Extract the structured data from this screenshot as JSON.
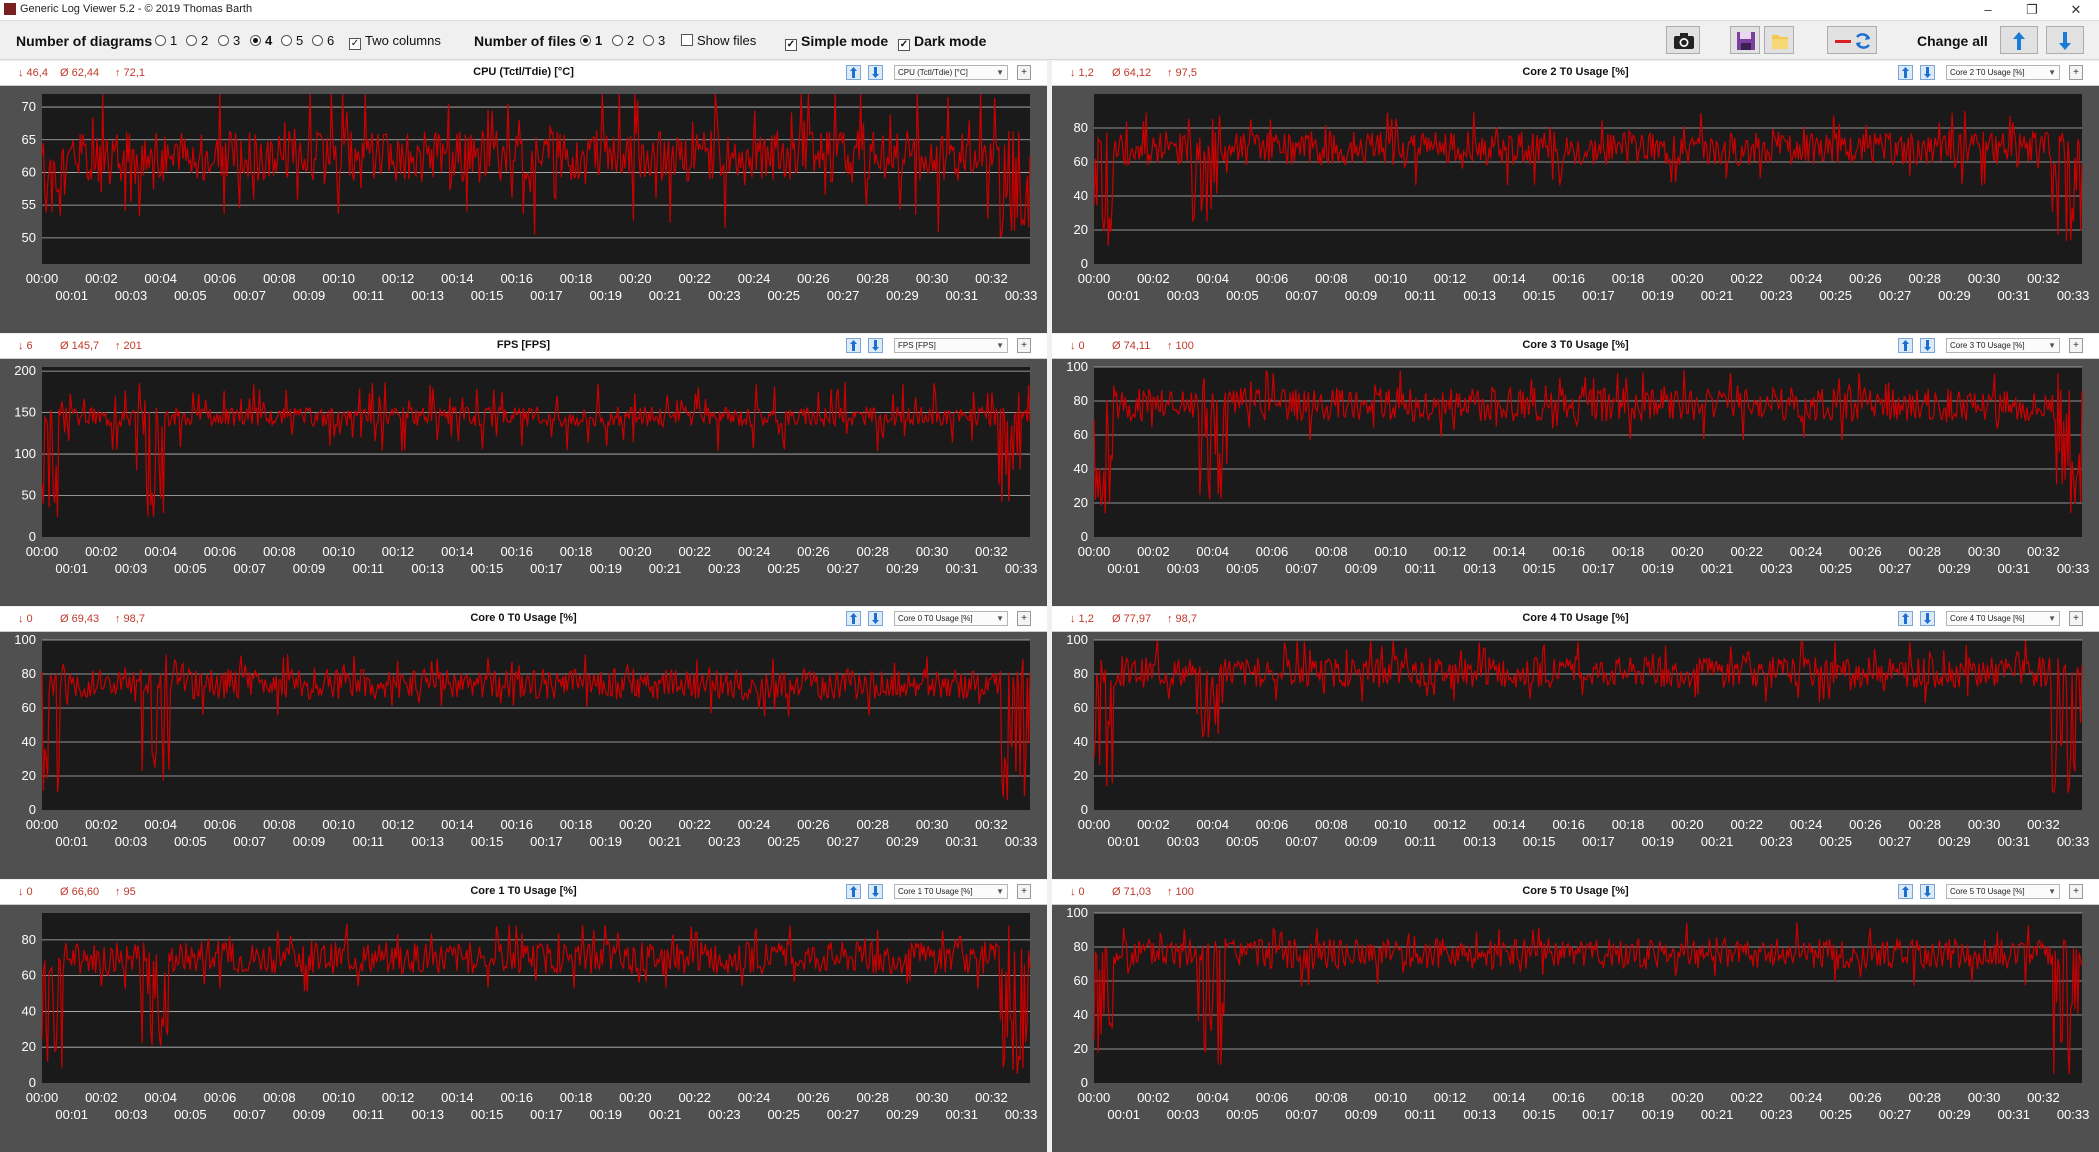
{
  "window": {
    "title": "Generic Log Viewer 5.2 - © 2019 Thomas Barth",
    "minimize": "–",
    "restore": "❐",
    "close": "✕"
  },
  "toolbar": {
    "num_diagrams_label": "Number of diagrams",
    "diagram_options": [
      "1",
      "2",
      "3",
      "4",
      "5",
      "6"
    ],
    "diagram_selected": "4",
    "two_columns_label": "Two columns",
    "two_columns_checked": true,
    "num_files_label": "Number of files",
    "file_options": [
      "1",
      "2",
      "3"
    ],
    "file_selected": "1",
    "show_files_label": "Show files",
    "show_files_checked": false,
    "simple_mode_label": "Simple mode",
    "simple_mode_checked": true,
    "dark_mode_label": "Dark mode",
    "dark_mode_checked": true,
    "change_all_label": "Change all",
    "icons": [
      "camera-icon",
      "save-icon",
      "folder-icon",
      "swap-icon",
      "arrow-up-icon",
      "arrow-down-icon"
    ]
  },
  "colors": {
    "line": "#cc0000",
    "plot_bg": "#1a1a1a",
    "frame_bg": "#505050",
    "grid": "#bbbbbb",
    "stat": "#c0392b"
  },
  "charts": [
    {
      "title": "CPU (Tctl/Tdie) [°C]",
      "select": "CPU (Tctl/Tdie) [°C]",
      "min": "↓ 46,4",
      "avg": "Ø 62,44",
      "max": "↑ 72,1"
    },
    {
      "title": "Core 2 T0 Usage [%]",
      "select": "Core 2 T0 Usage [%]",
      "min": "↓ 1,2",
      "avg": "Ø 64,12",
      "max": "↑ 97,5"
    },
    {
      "title": "FPS [FPS]",
      "select": "FPS [FPS]",
      "min": "↓ 6",
      "avg": "Ø 145,7",
      "max": "↑ 201"
    },
    {
      "title": "Core 3 T0 Usage [%]",
      "select": "Core 3 T0 Usage [%]",
      "min": "↓ 0",
      "avg": "Ø 74,11",
      "max": "↑ 100"
    },
    {
      "title": "Core 0 T0 Usage [%]",
      "select": "Core 0 T0 Usage [%]",
      "min": "↓ 0",
      "avg": "Ø 69,43",
      "max": "↑ 98,7"
    },
    {
      "title": "Core 4 T0 Usage [%]",
      "select": "Core 4 T0 Usage [%]",
      "min": "↓ 1,2",
      "avg": "Ø 77,97",
      "max": "↑ 98,7"
    },
    {
      "title": "Core 1 T0 Usage [%]",
      "select": "Core 1 T0 Usage [%]",
      "min": "↓ 0",
      "avg": "Ø 66,60",
      "max": "↑ 95"
    },
    {
      "title": "Core 5 T0 Usage [%]",
      "select": "Core 5 T0 Usage [%]",
      "min": "↓ 0",
      "avg": "Ø 71,03",
      "max": "↑ 100"
    }
  ],
  "chart_data": [
    {
      "type": "line",
      "title": "CPU (Tctl/Tdie) [°C]",
      "ylim": [
        46,
        72
      ],
      "yticks": [
        50,
        55,
        60,
        65,
        70
      ],
      "x_range_minutes": [
        0,
        33.3
      ],
      "seed": 1,
      "mean": 62.4,
      "spread": 4,
      "spike": 8,
      "dips": [
        [
          0.3,
          52
        ],
        [
          32.8,
          50
        ]
      ],
      "x_ticks": [
        "00:00",
        "00:01",
        "00:02",
        "00:03",
        "00:04",
        "00:05",
        "00:06",
        "00:07",
        "00:08",
        "00:09",
        "00:10",
        "00:11",
        "00:12",
        "00:13",
        "00:14",
        "00:15",
        "00:16",
        "00:17",
        "00:18",
        "00:19",
        "00:20",
        "00:21",
        "00:22",
        "00:23",
        "00:24",
        "00:25",
        "00:26",
        "00:27",
        "00:28",
        "00:29",
        "00:30",
        "00:31",
        "00:32",
        "00:33"
      ]
    },
    {
      "type": "line",
      "title": "Core 2 T0 Usage [%]",
      "ylim": [
        0,
        100
      ],
      "yticks": [
        0,
        20,
        40,
        60,
        80
      ],
      "x_range_minutes": [
        0,
        33.3
      ],
      "seed": 2,
      "mean": 68,
      "spread": 10,
      "spike": 12,
      "dips": [
        [
          0.2,
          10
        ],
        [
          3.8,
          25
        ],
        [
          32.8,
          10
        ]
      ],
      "x_ticks": [
        "00:00",
        "00:01",
        "00:02",
        "00:03",
        "00:04",
        "00:05",
        "00:06",
        "00:07",
        "00:08",
        "00:09",
        "00:10",
        "00:11",
        "00:12",
        "00:13",
        "00:14",
        "00:15",
        "00:16",
        "00:17",
        "00:18",
        "00:19",
        "00:20",
        "00:21",
        "00:22",
        "00:23",
        "00:24",
        "00:25",
        "00:26",
        "00:27",
        "00:28",
        "00:29",
        "00:30",
        "00:31",
        "00:32",
        "00:33"
      ]
    },
    {
      "type": "line",
      "title": "FPS [FPS]",
      "ylim": [
        0,
        205
      ],
      "yticks": [
        0,
        50,
        100,
        150,
        200
      ],
      "x_range_minutes": [
        0,
        33.3
      ],
      "seed": 3,
      "mean": 145,
      "spread": 12,
      "spike": 30,
      "dips": [
        [
          0.3,
          10
        ],
        [
          3.6,
          20
        ],
        [
          32.5,
          40
        ]
      ],
      "x_ticks": [
        "00:00",
        "00:01",
        "00:02",
        "00:03",
        "00:04",
        "00:05",
        "00:06",
        "00:07",
        "00:08",
        "00:09",
        "00:10",
        "00:11",
        "00:12",
        "00:13",
        "00:14",
        "00:15",
        "00:16",
        "00:17",
        "00:18",
        "00:19",
        "00:20",
        "00:21",
        "00:22",
        "00:23",
        "00:24",
        "00:25",
        "00:26",
        "00:27",
        "00:28",
        "00:29",
        "00:30",
        "00:31",
        "00:32",
        "00:33"
      ]
    },
    {
      "type": "line",
      "title": "Core 3 T0 Usage [%]",
      "ylim": [
        0,
        100
      ],
      "yticks": [
        0,
        20,
        40,
        60,
        80,
        100
      ],
      "x_range_minutes": [
        0,
        33.3
      ],
      "seed": 4,
      "mean": 78,
      "spread": 10,
      "spike": 12,
      "dips": [
        [
          0.2,
          10
        ],
        [
          4.0,
          20
        ],
        [
          32.8,
          10
        ]
      ],
      "x_ticks": [
        "00:00",
        "00:01",
        "00:02",
        "00:03",
        "00:04",
        "00:05",
        "00:06",
        "00:07",
        "00:08",
        "00:09",
        "00:10",
        "00:11",
        "00:12",
        "00:13",
        "00:14",
        "00:15",
        "00:16",
        "00:17",
        "00:18",
        "00:19",
        "00:20",
        "00:21",
        "00:22",
        "00:23",
        "00:24",
        "00:25",
        "00:26",
        "00:27",
        "00:28",
        "00:29",
        "00:30",
        "00:31",
        "00:32",
        "00:33"
      ]
    },
    {
      "type": "line",
      "title": "Core 0 T0 Usage [%]",
      "ylim": [
        0,
        100
      ],
      "yticks": [
        0,
        20,
        40,
        60,
        80,
        100
      ],
      "x_range_minutes": [
        0,
        33.3
      ],
      "seed": 5,
      "mean": 74,
      "spread": 9,
      "spike": 10,
      "dips": [
        [
          0.2,
          5
        ],
        [
          3.8,
          15
        ],
        [
          32.8,
          5
        ]
      ],
      "x_ticks": [
        "00:00",
        "00:01",
        "00:02",
        "00:03",
        "00:04",
        "00:05",
        "00:06",
        "00:07",
        "00:08",
        "00:09",
        "00:10",
        "00:11",
        "00:12",
        "00:13",
        "00:14",
        "00:15",
        "00:16",
        "00:17",
        "00:18",
        "00:19",
        "00:20",
        "00:21",
        "00:22",
        "00:23",
        "00:24",
        "00:25",
        "00:26",
        "00:27",
        "00:28",
        "00:29",
        "00:30",
        "00:31",
        "00:32",
        "00:33"
      ]
    },
    {
      "type": "line",
      "title": "Core 4 T0 Usage [%]",
      "ylim": [
        0,
        100
      ],
      "yticks": [
        0,
        20,
        40,
        60,
        80,
        100
      ],
      "x_range_minutes": [
        0,
        33.3
      ],
      "seed": 6,
      "mean": 81,
      "spread": 9,
      "spike": 10,
      "dips": [
        [
          0.2,
          10
        ],
        [
          3.9,
          40
        ],
        [
          32.8,
          10
        ]
      ],
      "x_ticks": [
        "00:00",
        "00:01",
        "00:02",
        "00:03",
        "00:04",
        "00:05",
        "00:06",
        "00:07",
        "00:08",
        "00:09",
        "00:10",
        "00:11",
        "00:12",
        "00:13",
        "00:14",
        "00:15",
        "00:16",
        "00:17",
        "00:18",
        "00:19",
        "00:20",
        "00:21",
        "00:22",
        "00:23",
        "00:24",
        "00:25",
        "00:26",
        "00:27",
        "00:28",
        "00:29",
        "00:30",
        "00:31",
        "00:32",
        "00:33"
      ]
    },
    {
      "type": "line",
      "title": "Core 1 T0 Usage [%]",
      "ylim": [
        0,
        95
      ],
      "yticks": [
        0,
        20,
        40,
        60,
        80
      ],
      "x_range_minutes": [
        0,
        33.3
      ],
      "seed": 7,
      "mean": 70,
      "spread": 9,
      "spike": 10,
      "dips": [
        [
          0.2,
          5
        ],
        [
          3.8,
          20
        ],
        [
          32.8,
          5
        ]
      ],
      "x_ticks": [
        "00:00",
        "00:01",
        "00:02",
        "00:03",
        "00:04",
        "00:05",
        "00:06",
        "00:07",
        "00:08",
        "00:09",
        "00:10",
        "00:11",
        "00:12",
        "00:13",
        "00:14",
        "00:15",
        "00:16",
        "00:17",
        "00:18",
        "00:19",
        "00:20",
        "00:21",
        "00:22",
        "00:23",
        "00:24",
        "00:25",
        "00:26",
        "00:27",
        "00:28",
        "00:29",
        "00:30",
        "00:31",
        "00:32",
        "00:33"
      ]
    },
    {
      "type": "line",
      "title": "Core 5 T0 Usage [%]",
      "ylim": [
        0,
        100
      ],
      "yticks": [
        0,
        20,
        40,
        60,
        80,
        100
      ],
      "x_range_minutes": [
        0,
        33.3
      ],
      "seed": 8,
      "mean": 76,
      "spread": 9,
      "spike": 10,
      "dips": [
        [
          0.2,
          10
        ],
        [
          4.0,
          10
        ],
        [
          32.8,
          5
        ]
      ],
      "x_ticks": [
        "00:00",
        "00:01",
        "00:02",
        "00:03",
        "00:04",
        "00:05",
        "00:06",
        "00:07",
        "00:08",
        "00:09",
        "00:10",
        "00:11",
        "00:12",
        "00:13",
        "00:14",
        "00:15",
        "00:16",
        "00:17",
        "00:18",
        "00:19",
        "00:20",
        "00:21",
        "00:22",
        "00:23",
        "00:24",
        "00:25",
        "00:26",
        "00:27",
        "00:28",
        "00:29",
        "00:30",
        "00:31",
        "00:32",
        "00:33"
      ]
    }
  ]
}
